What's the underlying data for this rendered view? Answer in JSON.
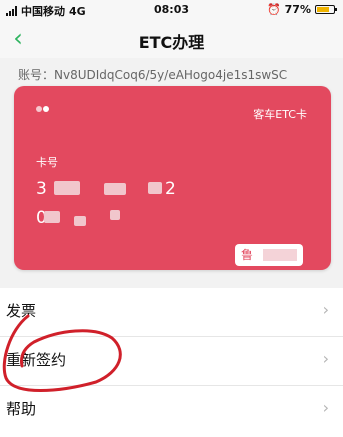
{
  "status_bar": {
    "carrier": "中国移动",
    "network": "4G",
    "time": "08:03",
    "battery": "77%",
    "battery_level": 0.77
  },
  "nav": {
    "title": "ETC办理"
  },
  "account": {
    "label": "账号：",
    "value": "Nv8UDIdqCoq6/5y/eAHogo4je1s1swSC"
  },
  "card": {
    "type": "客车ETC卡",
    "number_label": "卡号",
    "number_line1_start": "3",
    "number_line1_end": "2",
    "number_line2_start": "0",
    "plate_prefix": "鲁",
    "color": "#e3495f"
  },
  "menu": {
    "items": [
      {
        "label": "发票"
      },
      {
        "label": "重新签约"
      },
      {
        "label": "帮助"
      }
    ]
  },
  "colors": {
    "accent": "#2db35e",
    "annotation": "#d0202a"
  }
}
